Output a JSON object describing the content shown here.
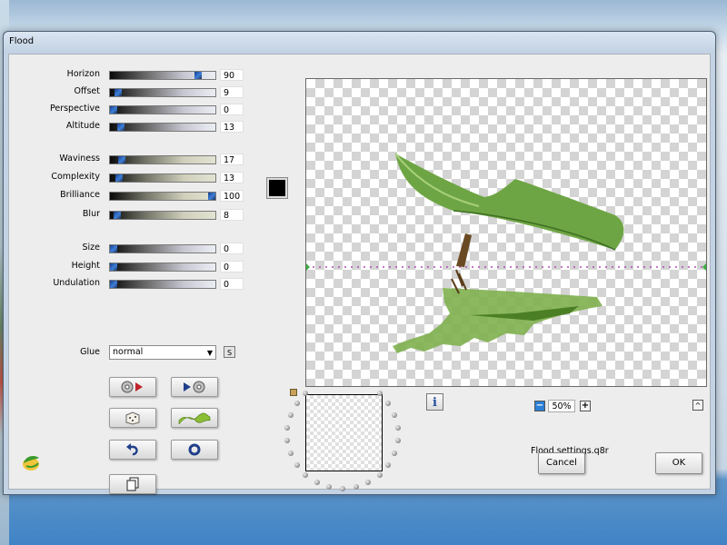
{
  "window": {
    "title": "Flood"
  },
  "sliders": [
    {
      "label": "Horizon",
      "value": "90",
      "level": 0.86
    },
    {
      "label": "Offset",
      "value": "9",
      "level": 0.05
    },
    {
      "label": "Perspective",
      "value": "0",
      "level": 0.0
    },
    {
      "label": "Altitude",
      "value": "13",
      "level": 0.07
    },
    {
      "label": "Waviness",
      "value": "17",
      "level": 0.08
    },
    {
      "label": "Complexity",
      "value": "13",
      "level": 0.06
    },
    {
      "label": "Brilliance",
      "value": "100",
      "level": 1.0
    },
    {
      "label": "Blur",
      "value": "8",
      "level": 0.04
    },
    {
      "label": "Size",
      "value": "0",
      "level": 0.0
    },
    {
      "label": "Height",
      "value": "0",
      "level": 0.0
    },
    {
      "label": "Undulation",
      "value": "0",
      "level": 0.0
    }
  ],
  "color_swatch": "#000000",
  "glue": {
    "label": "Glue",
    "value": "normal",
    "s_label": "S"
  },
  "preview": {
    "zoom": "50%",
    "filename": "Flood settings.q8r"
  },
  "buttons": {
    "cancel": "Cancel",
    "ok": "OK"
  },
  "icons": [
    "load-preset-icon",
    "save-preset-icon",
    "random-dice-icon",
    "wave-icon",
    "undo-icon",
    "reset-icon",
    "copy-icon",
    "info-icon",
    "zoom-out-icon",
    "zoom-in-icon",
    "collapse-up-icon",
    "app-logo-icon"
  ],
  "colors": {
    "accent": "#2a5fb8",
    "window_bg": "#ededed",
    "leaf": "#6ea544"
  }
}
